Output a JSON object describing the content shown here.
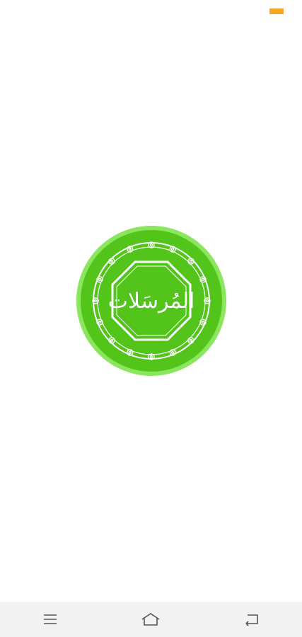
{
  "colors": {
    "background": "#ffffff",
    "status_indicator": "#f5a623",
    "logo_outer_ring": "#8ae65c",
    "logo_fill": "#52c41a",
    "logo_ornament": "#ffffff",
    "nav_bar_bg": "#f2f2f2",
    "nav_icon": "#555555"
  },
  "splash": {
    "title": "المُرسَلات"
  },
  "nav_bar": {
    "menu_icon": "menu-icon",
    "home_icon": "home-icon",
    "back_icon": "back-icon"
  }
}
